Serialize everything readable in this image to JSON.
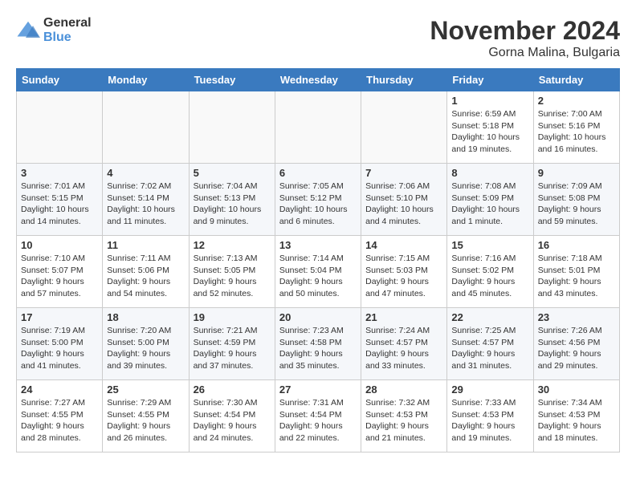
{
  "header": {
    "logo_general": "General",
    "logo_blue": "Blue",
    "month_title": "November 2024",
    "location": "Gorna Malina, Bulgaria"
  },
  "weekdays": [
    "Sunday",
    "Monday",
    "Tuesday",
    "Wednesday",
    "Thursday",
    "Friday",
    "Saturday"
  ],
  "weeks": [
    [
      {
        "day": "",
        "info": ""
      },
      {
        "day": "",
        "info": ""
      },
      {
        "day": "",
        "info": ""
      },
      {
        "day": "",
        "info": ""
      },
      {
        "day": "",
        "info": ""
      },
      {
        "day": "1",
        "info": "Sunrise: 6:59 AM\nSunset: 5:18 PM\nDaylight: 10 hours and 19 minutes."
      },
      {
        "day": "2",
        "info": "Sunrise: 7:00 AM\nSunset: 5:16 PM\nDaylight: 10 hours and 16 minutes."
      }
    ],
    [
      {
        "day": "3",
        "info": "Sunrise: 7:01 AM\nSunset: 5:15 PM\nDaylight: 10 hours and 14 minutes."
      },
      {
        "day": "4",
        "info": "Sunrise: 7:02 AM\nSunset: 5:14 PM\nDaylight: 10 hours and 11 minutes."
      },
      {
        "day": "5",
        "info": "Sunrise: 7:04 AM\nSunset: 5:13 PM\nDaylight: 10 hours and 9 minutes."
      },
      {
        "day": "6",
        "info": "Sunrise: 7:05 AM\nSunset: 5:12 PM\nDaylight: 10 hours and 6 minutes."
      },
      {
        "day": "7",
        "info": "Sunrise: 7:06 AM\nSunset: 5:10 PM\nDaylight: 10 hours and 4 minutes."
      },
      {
        "day": "8",
        "info": "Sunrise: 7:08 AM\nSunset: 5:09 PM\nDaylight: 10 hours and 1 minute."
      },
      {
        "day": "9",
        "info": "Sunrise: 7:09 AM\nSunset: 5:08 PM\nDaylight: 9 hours and 59 minutes."
      }
    ],
    [
      {
        "day": "10",
        "info": "Sunrise: 7:10 AM\nSunset: 5:07 PM\nDaylight: 9 hours and 57 minutes."
      },
      {
        "day": "11",
        "info": "Sunrise: 7:11 AM\nSunset: 5:06 PM\nDaylight: 9 hours and 54 minutes."
      },
      {
        "day": "12",
        "info": "Sunrise: 7:13 AM\nSunset: 5:05 PM\nDaylight: 9 hours and 52 minutes."
      },
      {
        "day": "13",
        "info": "Sunrise: 7:14 AM\nSunset: 5:04 PM\nDaylight: 9 hours and 50 minutes."
      },
      {
        "day": "14",
        "info": "Sunrise: 7:15 AM\nSunset: 5:03 PM\nDaylight: 9 hours and 47 minutes."
      },
      {
        "day": "15",
        "info": "Sunrise: 7:16 AM\nSunset: 5:02 PM\nDaylight: 9 hours and 45 minutes."
      },
      {
        "day": "16",
        "info": "Sunrise: 7:18 AM\nSunset: 5:01 PM\nDaylight: 9 hours and 43 minutes."
      }
    ],
    [
      {
        "day": "17",
        "info": "Sunrise: 7:19 AM\nSunset: 5:00 PM\nDaylight: 9 hours and 41 minutes."
      },
      {
        "day": "18",
        "info": "Sunrise: 7:20 AM\nSunset: 5:00 PM\nDaylight: 9 hours and 39 minutes."
      },
      {
        "day": "19",
        "info": "Sunrise: 7:21 AM\nSunset: 4:59 PM\nDaylight: 9 hours and 37 minutes."
      },
      {
        "day": "20",
        "info": "Sunrise: 7:23 AM\nSunset: 4:58 PM\nDaylight: 9 hours and 35 minutes."
      },
      {
        "day": "21",
        "info": "Sunrise: 7:24 AM\nSunset: 4:57 PM\nDaylight: 9 hours and 33 minutes."
      },
      {
        "day": "22",
        "info": "Sunrise: 7:25 AM\nSunset: 4:57 PM\nDaylight: 9 hours and 31 minutes."
      },
      {
        "day": "23",
        "info": "Sunrise: 7:26 AM\nSunset: 4:56 PM\nDaylight: 9 hours and 29 minutes."
      }
    ],
    [
      {
        "day": "24",
        "info": "Sunrise: 7:27 AM\nSunset: 4:55 PM\nDaylight: 9 hours and 28 minutes."
      },
      {
        "day": "25",
        "info": "Sunrise: 7:29 AM\nSunset: 4:55 PM\nDaylight: 9 hours and 26 minutes."
      },
      {
        "day": "26",
        "info": "Sunrise: 7:30 AM\nSunset: 4:54 PM\nDaylight: 9 hours and 24 minutes."
      },
      {
        "day": "27",
        "info": "Sunrise: 7:31 AM\nSunset: 4:54 PM\nDaylight: 9 hours and 22 minutes."
      },
      {
        "day": "28",
        "info": "Sunrise: 7:32 AM\nSunset: 4:53 PM\nDaylight: 9 hours and 21 minutes."
      },
      {
        "day": "29",
        "info": "Sunrise: 7:33 AM\nSunset: 4:53 PM\nDaylight: 9 hours and 19 minutes."
      },
      {
        "day": "30",
        "info": "Sunrise: 7:34 AM\nSunset: 4:53 PM\nDaylight: 9 hours and 18 minutes."
      }
    ]
  ]
}
